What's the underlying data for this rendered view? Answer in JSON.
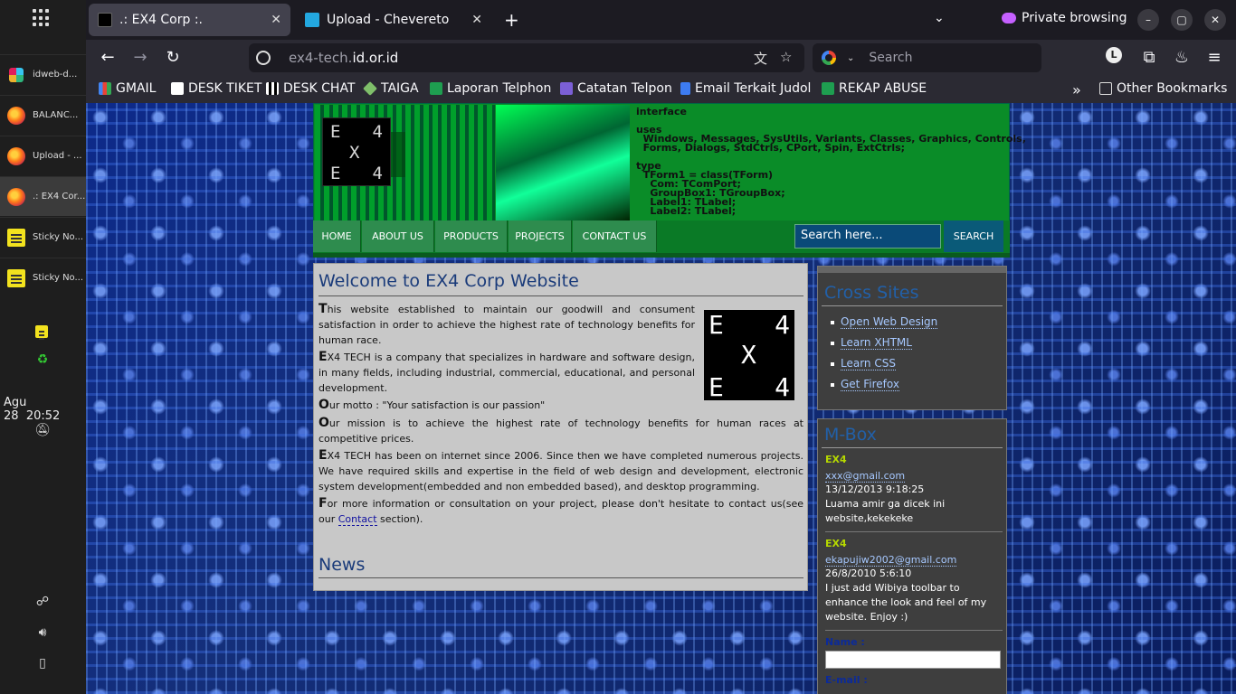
{
  "dock": {
    "items": [
      {
        "label": "idweb-d..."
      },
      {
        "label": "BALANC..."
      },
      {
        "label": "Upload - ..."
      },
      {
        "label": ".: EX4 Cor..."
      },
      {
        "label": "Sticky No..."
      },
      {
        "label": "Sticky No..."
      }
    ],
    "date": "Agu 28",
    "time": "20:52"
  },
  "browser": {
    "tabs": [
      {
        "title": ".: EX4 Corp :."
      },
      {
        "title": "Upload - Chevereto"
      }
    ],
    "private_label": "Private browsing",
    "url_host": "ex4-tech.",
    "url_domain": "id.or.id",
    "search_placeholder": "Search",
    "bookmarks": [
      "GMAIL",
      "DESK TIKET",
      "DESK CHAT",
      "TAIGA",
      "Laporan Telphon",
      "Catatan Telpon",
      "Email Terkait Judol",
      "REKAP ABUSE"
    ],
    "other_bookmarks": "Other Bookmarks"
  },
  "site": {
    "logo_chars": [
      "E",
      "4",
      "X",
      "E",
      "4"
    ],
    "header_code": "interface\n\nuses\n  Windows, Messages, SysUtils, Variants, Classes, Graphics, Controls,\n  Forms, Dialogs, StdCtrls, CPort, Spin, ExtCtrls;\n\ntype\n  TForm1 = class(TForm)\n    Com: TComPort;\n    GroupBox1: TGroupBox;\n    Label1: TLabel;\n    Label2: TLabel;",
    "menu": [
      "HOME",
      "ABOUT US",
      "PRODUCTS",
      "PROJECTS",
      "CONTACT US"
    ],
    "search_value": "Search here...",
    "search_button": "SEARCH",
    "welcome_title": "Welcome to EX4 Corp Website",
    "paragraphs": [
      {
        "first": "T",
        "rest": "his website established to maintain our goodwill and consument satisfaction in order to achieve the highest rate of technology benefits for human race."
      },
      {
        "first": "E",
        "rest": "X4 TECH is a company that specializes in hardware and software design, in many fields, including industrial, commercial, educational, and personal development."
      },
      {
        "first": "O",
        "rest": "ur motto : \"Your satisfaction is our passion\""
      },
      {
        "first": "O",
        "rest": "ur mission is to achieve the highest rate of technology benefits for human races at competitive prices."
      },
      {
        "first": "E",
        "rest": "X4 TECH has been on internet since 2006. Since then we have completed numerous projects. We have required skills and expertise in the field of web design and development, electronic system development(embedded and non embedded based), and desktop programming."
      },
      {
        "first": "F",
        "rest": "or more information or consultation on your project, please don't hesitate to contact us(see our "
      }
    ],
    "contact_link": "Contact",
    "contact_tail": " section).",
    "news_title": "News",
    "cross_sites_title": "Cross Sites",
    "cross_sites": [
      "Open Web Design",
      "Learn XHTML",
      "Learn CSS",
      "Get Firefox"
    ],
    "mbox_title": "M-Box",
    "messages": [
      {
        "name": "EX4",
        "email": "xxx@gmail.com",
        "date": "13/12/2013 9:18:25",
        "text": "Luama amir ga dicek ini website,kekekeke"
      },
      {
        "name": "EX4",
        "email": "ekapujiw2002@gmail.com",
        "date": "26/8/2010 5:6:10",
        "text": "I just add Wibiya toolbar to enhance the look and feel of my website. Enjoy :)"
      }
    ],
    "form_name_label": "Name :",
    "form_email_label": "E-mail :"
  }
}
